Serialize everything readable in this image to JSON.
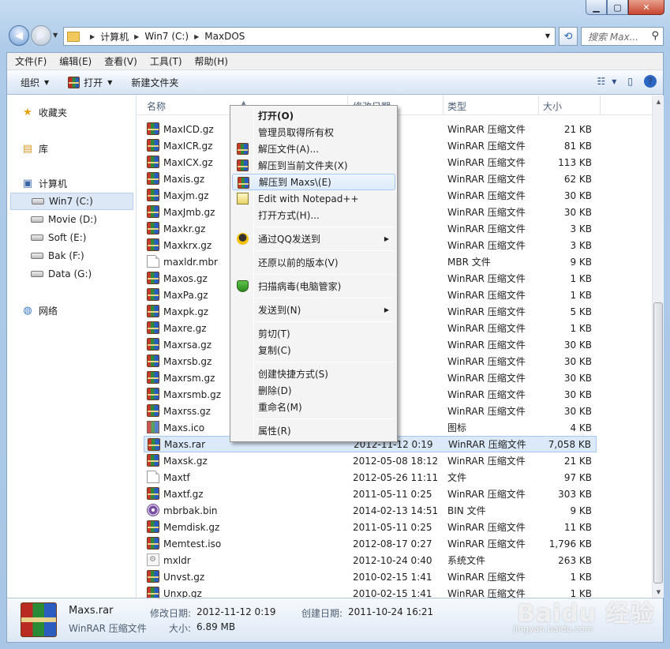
{
  "window": {
    "address": [
      "计算机",
      "Win7 (C:)",
      "MaxDOS"
    ],
    "search_placeholder": "搜索 Max..."
  },
  "menu": [
    "文件(F)",
    "编辑(E)",
    "查看(V)",
    "工具(T)",
    "帮助(H)"
  ],
  "toolbar": {
    "organize": "组织",
    "open": "打开",
    "new_folder": "新建文件夹"
  },
  "nav": {
    "favorites": "收藏夹",
    "library": "库",
    "computer": "计算机",
    "drives": [
      "Win7 (C:)",
      "Movie (D:)",
      "Soft (E:)",
      "Bak (F:)",
      "Data (G:)"
    ],
    "network": "网络"
  },
  "columns": {
    "name": "名称",
    "date": "修改日期",
    "type": "类型",
    "size": "大小"
  },
  "files": [
    {
      "name": "MaxICD.gz",
      "date": "2 11:43",
      "type": "WinRAR 压缩文件",
      "size": "21 KB",
      "icon": "rar"
    },
    {
      "name": "MaxICR.gz",
      "date": "9 11:40",
      "type": "WinRAR 压缩文件",
      "size": "81 KB",
      "icon": "rar"
    },
    {
      "name": "MaxICX.gz",
      "date": "9 11:40",
      "type": "WinRAR 压缩文件",
      "size": "113 KB",
      "icon": "rar"
    },
    {
      "name": "Maxis.gz",
      "date": "2 18:26",
      "type": "WinRAR 压缩文件",
      "size": "62 KB",
      "icon": "rar"
    },
    {
      "name": "Maxjm.gz",
      "date": "6 0:56",
      "type": "WinRAR 压缩文件",
      "size": "30 KB",
      "icon": "rar"
    },
    {
      "name": "MaxJmb.gz",
      "date": "6 1:05",
      "type": "WinRAR 压缩文件",
      "size": "30 KB",
      "icon": "rar"
    },
    {
      "name": "Maxkr.gz",
      "date": "3 14:51",
      "type": "WinRAR 压缩文件",
      "size": "3 KB",
      "icon": "rar"
    },
    {
      "name": "Maxkrx.gz",
      "date": "3 14:51",
      "type": "WinRAR 压缩文件",
      "size": "3 KB",
      "icon": "rar"
    },
    {
      "name": "maxldr.mbr",
      "date": "8 16:40",
      "type": "MBR 文件",
      "size": "9 KB",
      "icon": "file"
    },
    {
      "name": "Maxos.gz",
      "date": "1 0:00",
      "type": "WinRAR 压缩文件",
      "size": "1 KB",
      "icon": "rar"
    },
    {
      "name": "MaxPa.gz",
      "date": "7 0:47",
      "type": "WinRAR 压缩文件",
      "size": "1 KB",
      "icon": "rar"
    },
    {
      "name": "Maxpk.gz",
      "date": "7 10:02",
      "type": "WinRAR 压缩文件",
      "size": "5 KB",
      "icon": "rar"
    },
    {
      "name": "Maxre.gz",
      "date": "3 14:51",
      "type": "WinRAR 压缩文件",
      "size": "1 KB",
      "icon": "rar"
    },
    {
      "name": "Maxrsa.gz",
      "date": "6 0:52",
      "type": "WinRAR 压缩文件",
      "size": "30 KB",
      "icon": "rar"
    },
    {
      "name": "Maxrsb.gz",
      "date": "6 1:41",
      "type": "WinRAR 压缩文件",
      "size": "30 KB",
      "icon": "rar"
    },
    {
      "name": "Maxrsm.gz",
      "date": "6 0:54",
      "type": "WinRAR 压缩文件",
      "size": "30 KB",
      "icon": "rar"
    },
    {
      "name": "Maxrsmb.gz",
      "date": "6 1:08",
      "type": "WinRAR 压缩文件",
      "size": "30 KB",
      "icon": "rar"
    },
    {
      "name": "Maxrss.gz",
      "date": "6 1:54",
      "type": "WinRAR 压缩文件",
      "size": "30 KB",
      "icon": "rar"
    },
    {
      "name": "Maxs.ico",
      "date": "2 22:31",
      "type": "图标",
      "size": "4 KB",
      "icon": "ico"
    },
    {
      "name": "Maxs.rar",
      "date": "2012-11-12 0:19",
      "type": "WinRAR 压缩文件",
      "size": "7,058 KB",
      "icon": "rar",
      "selected": true
    },
    {
      "name": "Maxsk.gz",
      "date": "2012-05-08 18:12",
      "type": "WinRAR 压缩文件",
      "size": "21 KB",
      "icon": "rar"
    },
    {
      "name": "Maxtf",
      "date": "2012-05-26 11:11",
      "type": "文件",
      "size": "97 KB",
      "icon": "file"
    },
    {
      "name": "Maxtf.gz",
      "date": "2011-05-11 0:25",
      "type": "WinRAR 压缩文件",
      "size": "303 KB",
      "icon": "rar"
    },
    {
      "name": "mbrbak.bin",
      "date": "2014-02-13 14:51",
      "type": "BIN 文件",
      "size": "9 KB",
      "icon": "bin"
    },
    {
      "name": "Memdisk.gz",
      "date": "2011-05-11 0:25",
      "type": "WinRAR 压缩文件",
      "size": "11 KB",
      "icon": "rar"
    },
    {
      "name": "Memtest.iso",
      "date": "2012-08-17 0:27",
      "type": "WinRAR 压缩文件",
      "size": "1,796 KB",
      "icon": "rar"
    },
    {
      "name": "mxldr",
      "date": "2012-10-24 0:40",
      "type": "系统文件",
      "size": "263 KB",
      "icon": "sys"
    },
    {
      "name": "Unvst.gz",
      "date": "2010-02-15 1:41",
      "type": "WinRAR 压缩文件",
      "size": "1 KB",
      "icon": "rar"
    },
    {
      "name": "Unxp.gz",
      "date": "2010-02-15 1:41",
      "type": "WinRAR 压缩文件",
      "size": "1 KB",
      "icon": "rar"
    }
  ],
  "context_menu": [
    {
      "label": "打开(O)",
      "bold": true
    },
    {
      "label": "管理员取得所有权"
    },
    {
      "label": "解压文件(A)...",
      "icon": "rar"
    },
    {
      "label": "解压到当前文件夹(X)",
      "icon": "rar"
    },
    {
      "label": "解压到 Maxs\\(E)",
      "icon": "rar",
      "highlight": true
    },
    {
      "label": "Edit with Notepad++",
      "icon": "notepad"
    },
    {
      "label": "打开方式(H)..."
    },
    {
      "sep": true
    },
    {
      "label": "通过QQ发送到",
      "icon": "qq",
      "submenu": true
    },
    {
      "sep": true
    },
    {
      "label": "还原以前的版本(V)"
    },
    {
      "sep": true
    },
    {
      "label": "扫描病毒(电脑管家)",
      "icon": "shield"
    },
    {
      "sep": true
    },
    {
      "label": "发送到(N)",
      "submenu": true
    },
    {
      "sep": true
    },
    {
      "label": "剪切(T)"
    },
    {
      "label": "复制(C)"
    },
    {
      "sep": true
    },
    {
      "label": "创建快捷方式(S)"
    },
    {
      "label": "删除(D)"
    },
    {
      "label": "重命名(M)"
    },
    {
      "sep": true
    },
    {
      "label": "属性(R)"
    }
  ],
  "details": {
    "name": "Maxs.rar",
    "type": "WinRAR 压缩文件",
    "modified_label": "修改日期:",
    "modified": "2012-11-12 0:19",
    "created_label": "创建日期:",
    "created": "2011-10-24 16:21",
    "size_label": "大小:",
    "size": "6.89 MB"
  },
  "watermark": {
    "main": "Baidu 经验",
    "sub": "jingyan.baidu.com"
  }
}
